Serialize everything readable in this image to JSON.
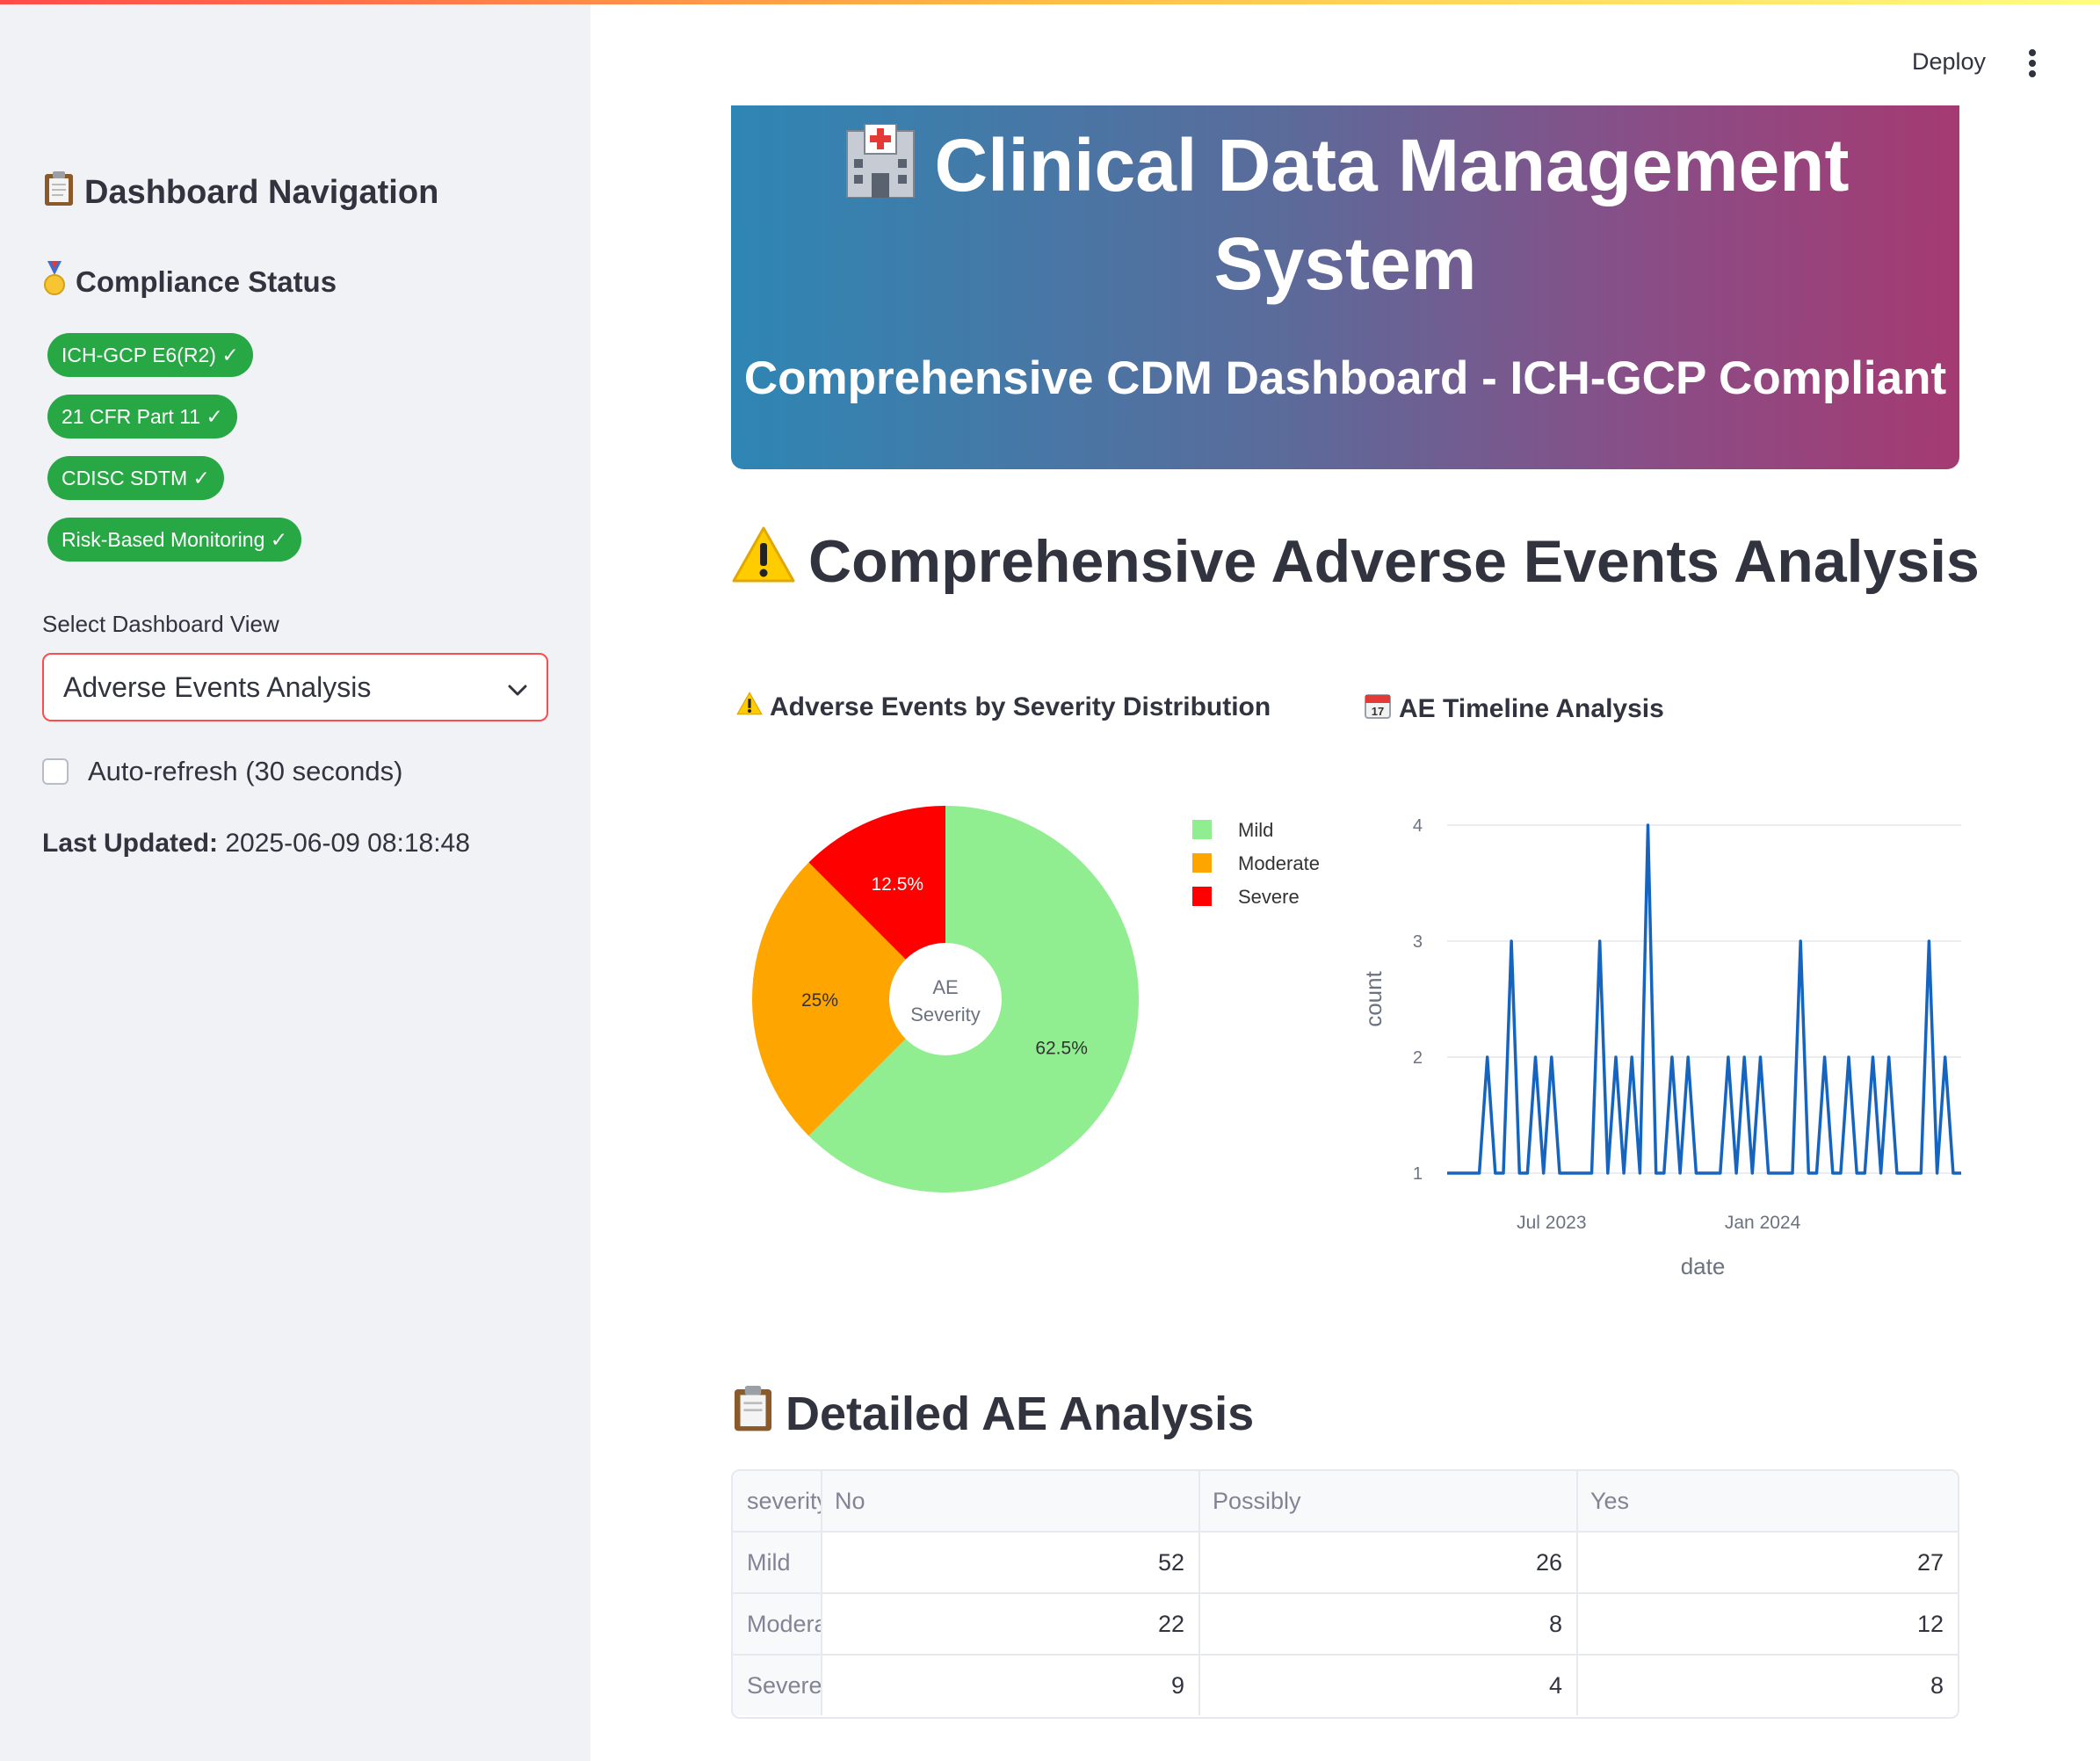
{
  "sidebar": {
    "nav_title": "Dashboard Navigation",
    "nav_icon": "clipboard-icon",
    "compliance_title": "Compliance Status",
    "compliance_icon": "medal-icon",
    "badges": [
      "ICH-GCP E6(R2) ✓",
      "21 CFR Part 11 ✓",
      "CDISC SDTM ✓",
      "Risk-Based Monitoring ✓"
    ],
    "badge_color": "#28a745",
    "select_label": "Select Dashboard View",
    "select_value": "Adverse Events Analysis",
    "autorefresh_label": "Auto-refresh (30 seconds)",
    "autorefresh_checked": false,
    "last_updated_label": "Last Updated:",
    "last_updated_value": "2025-06-09 08:18:48"
  },
  "header": {
    "deploy_label": "Deploy"
  },
  "banner": {
    "icon": "hospital-icon",
    "title_line1": "Clinical Data Management",
    "title_line2": "System",
    "subtitle": "Comprehensive CDM Dashboard - ICH-GCP Compliant"
  },
  "section": {
    "icon": "warning-icon",
    "title": "Comprehensive Adverse Events Analysis"
  },
  "charts": {
    "pie_title": "Adverse Events by Severity Distribution",
    "pie_icon": "warning-icon",
    "timeline_title": "AE Timeline Analysis",
    "timeline_icon": "calendar-icon"
  },
  "chart_data": [
    {
      "type": "pie",
      "hole_label": "AE Severity",
      "labels": [
        "Mild",
        "Moderate",
        "Severe"
      ],
      "values": [
        62.5,
        25,
        12.5
      ],
      "value_labels": [
        "62.5%",
        "25%",
        "12.5%"
      ],
      "colors": [
        "#90ee90",
        "#ffa500",
        "#ff0000"
      ],
      "legend_position": "right"
    },
    {
      "type": "line",
      "xlabel": "date",
      "ylabel": "count",
      "ylim": [
        1,
        4
      ],
      "yticks": [
        "1",
        "2",
        "3",
        "4"
      ],
      "xticks": [
        {
          "label": "Jul 2023",
          "date": "2023-07-01"
        },
        {
          "label": "Jan 2024",
          "date": "2024-01-01"
        }
      ],
      "color": "#1565c0",
      "grid": true,
      "x": [
        "2023-04-01",
        "2023-04-29",
        "2023-05-06",
        "2023-05-13",
        "2023-05-20",
        "2023-05-27",
        "2023-06-03",
        "2023-06-10",
        "2023-06-17",
        "2023-06-24",
        "2023-07-01",
        "2023-07-08",
        "2023-07-15",
        "2023-07-22",
        "2023-07-29",
        "2023-08-05",
        "2023-08-12",
        "2023-08-19",
        "2023-08-26",
        "2023-09-02",
        "2023-09-09",
        "2023-09-16",
        "2023-09-23",
        "2023-09-30",
        "2023-10-07",
        "2023-10-14",
        "2023-10-21",
        "2023-10-28",
        "2023-11-04",
        "2023-11-11",
        "2023-11-18",
        "2023-11-25",
        "2023-12-02",
        "2023-12-09",
        "2023-12-16",
        "2023-12-23",
        "2023-12-30",
        "2024-01-06",
        "2024-01-13",
        "2024-01-20",
        "2024-01-27",
        "2024-02-03",
        "2024-02-10",
        "2024-02-17",
        "2024-02-24",
        "2024-03-02",
        "2024-03-09",
        "2024-03-16",
        "2024-03-23",
        "2024-03-30",
        "2024-04-06",
        "2024-04-13",
        "2024-04-20",
        "2024-04-27",
        "2024-05-04",
        "2024-05-11",
        "2024-05-18",
        "2024-05-25",
        "2024-06-01",
        "2024-06-08",
        "2024-06-15",
        "2024-06-22"
      ],
      "values": [
        1,
        1,
        2,
        1,
        1,
        3,
        1,
        1,
        2,
        1,
        2,
        1,
        1,
        1,
        1,
        1,
        3,
        1,
        2,
        1,
        2,
        1,
        4,
        1,
        1,
        2,
        1,
        2,
        1,
        1,
        1,
        1,
        2,
        1,
        2,
        1,
        2,
        1,
        1,
        1,
        1,
        3,
        1,
        1,
        2,
        1,
        1,
        2,
        1,
        1,
        2,
        1,
        2,
        1,
        1,
        1,
        1,
        3,
        1,
        2,
        1,
        1
      ],
      "note": "values approximated from the rendered line"
    },
    {
      "type": "table",
      "columns": [
        "severity",
        "No",
        "Possibly",
        "Yes"
      ],
      "rows": [
        {
          "label": "Mild",
          "values": [
            "52",
            "26",
            "27"
          ]
        },
        {
          "label": "Moderate",
          "values": [
            "22",
            "8",
            "12"
          ]
        },
        {
          "label": "Severe",
          "values": [
            "9",
            "4",
            "8"
          ]
        }
      ]
    }
  ],
  "detail": {
    "icon": "clipboard-icon",
    "title": "Detailed AE Analysis"
  }
}
